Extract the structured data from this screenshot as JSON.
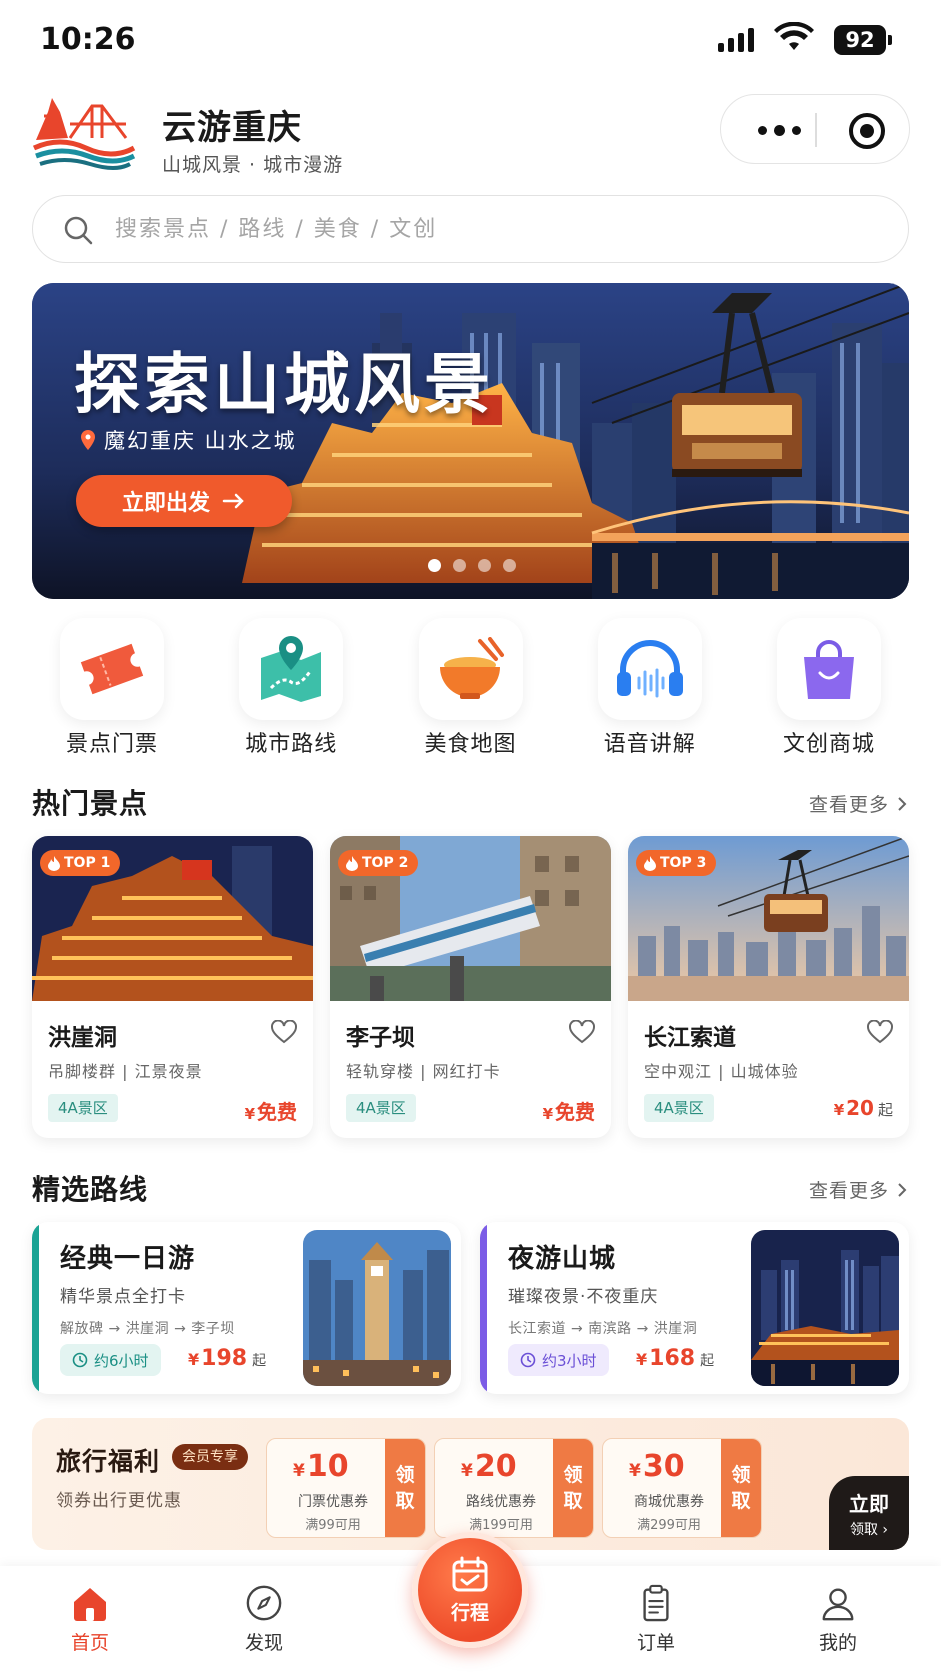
{
  "status_bar": {
    "time": "10:26",
    "battery": "92"
  },
  "header": {
    "title": "云游重庆",
    "subtitle": "山城风景 · 城市漫游"
  },
  "search": {
    "placeholder": "搜索景点 / 路线 / 美食 / 文创"
  },
  "banner": {
    "title": "探索山城风景",
    "subtitle": "魔幻重庆  山水之城",
    "cta": "立即出发",
    "page_count": 4,
    "active_index": 0
  },
  "quick_menu": [
    {
      "label": "景点门票",
      "icon": "ticket-icon"
    },
    {
      "label": "城市路线",
      "icon": "map-route-icon"
    },
    {
      "label": "美食地图",
      "icon": "food-bowl-icon"
    },
    {
      "label": "语音讲解",
      "icon": "headphones-icon"
    },
    {
      "label": "文创商城",
      "icon": "shopping-bag-icon"
    }
  ],
  "hot_spots": {
    "title": "热门景点",
    "more": "查看更多",
    "items": [
      {
        "rank": "TOP 1",
        "name": "洪崖洞",
        "desc": "吊脚楼群 | 江景夜景",
        "tag": "4A景区",
        "currency": "¥",
        "price": "免费",
        "unit": ""
      },
      {
        "rank": "TOP 2",
        "name": "李子坝",
        "desc": "轻轨穿楼 | 网红打卡",
        "tag": "4A景区",
        "currency": "¥",
        "price": "免费",
        "unit": ""
      },
      {
        "rank": "TOP 3",
        "name": "长江索道",
        "desc": "空中观江 | 山城体验",
        "tag": "4A景区",
        "currency": "¥",
        "price": "20",
        "unit": "起"
      }
    ]
  },
  "routes": {
    "title": "精选路线",
    "more": "查看更多",
    "items": [
      {
        "title": "经典一日游",
        "subtitle": "精华景点全打卡",
        "path": "解放碑 → 洪崖洞 → 李子坝",
        "duration": "约6小时",
        "currency": "¥",
        "price": "198",
        "unit": "起",
        "accent": "#1aa394"
      },
      {
        "title": "夜游山城",
        "subtitle": "璀璨夜景·不夜重庆",
        "path": "长江索道 → 南滨路 → 洪崖洞",
        "duration": "约3小时",
        "currency": "¥",
        "price": "168",
        "unit": "起",
        "accent": "#7b5ce6"
      }
    ]
  },
  "welfare": {
    "title": "旅行福利",
    "badge": "会员专享",
    "subtitle": "领券出行更优惠",
    "coupons": [
      {
        "currency": "¥",
        "amount": "10",
        "name": "门票优惠券",
        "condition": "满99可用",
        "button_1": "领",
        "button_2": "取"
      },
      {
        "currency": "¥",
        "amount": "20",
        "name": "路线优惠券",
        "condition": "满199可用",
        "button_1": "领",
        "button_2": "取"
      },
      {
        "currency": "¥",
        "amount": "30",
        "name": "商城优惠券",
        "condition": "满299可用",
        "button_1": "领",
        "button_2": "取"
      }
    ],
    "claim_1": "立即",
    "claim_2": "领取 ›"
  },
  "tabbar": {
    "home": "首页",
    "discover": "发现",
    "trip": "行程",
    "orders": "订单",
    "mine": "我的"
  },
  "colors": {
    "brand": "#e8452c",
    "teal": "#1aa394",
    "purple": "#7b5ce6"
  }
}
